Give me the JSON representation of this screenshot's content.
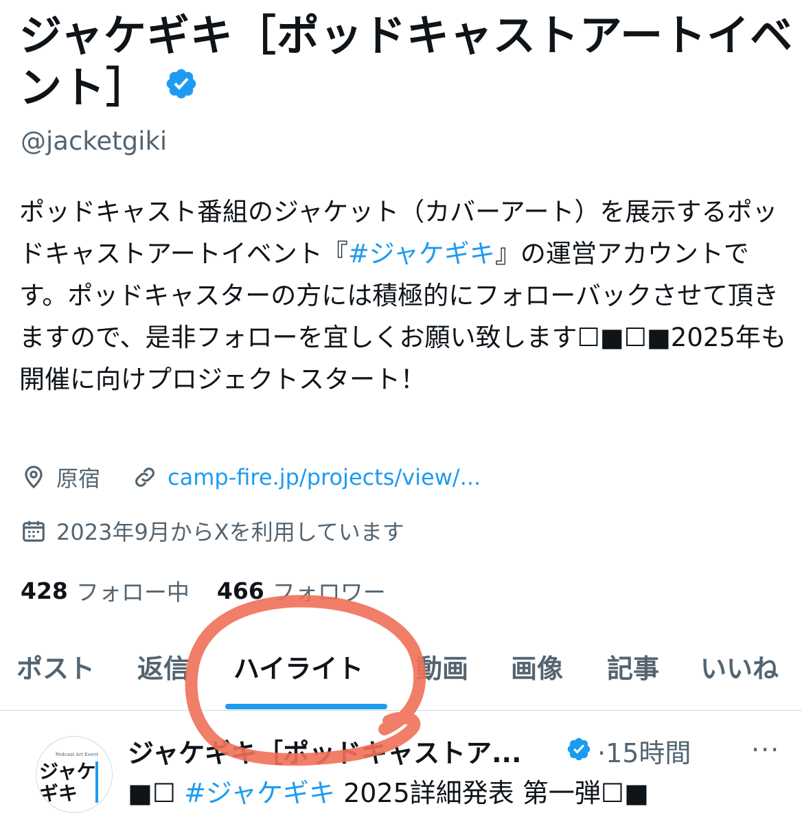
{
  "profile": {
    "name_line1": "ジャケギキ［ポッドキャストアートイベ",
    "name_line2": "ント］",
    "handle": "@jacketgiki",
    "bio_before_tag": "ポッドキャスト番組のジャケット（カバーアート）を展示するポッドキャストアートイベント『",
    "bio_tag": "#ジャケギキ",
    "bio_after_tag": "』の運営アカウントです。ポッドキャスターの方には積極的にフォローバックさせて頂きますので、是非フォローを宜しくお願い致します☐■☐■2025年も開催に向けプロジェクトスタート！",
    "location": "原宿",
    "link": "camp-fire.jp/projects/view/...",
    "joined": "2023年9月からXを利用しています",
    "following_count": "428",
    "following_label": "フォロー中",
    "followers_count": "466",
    "followers_label": "フォロワー"
  },
  "tabs": [
    {
      "label": "ポスト"
    },
    {
      "label": "返信"
    },
    {
      "label": "ハイライト"
    },
    {
      "label": "動画"
    },
    {
      "label": "画像"
    },
    {
      "label": "記事"
    },
    {
      "label": "いいね"
    }
  ],
  "active_tab": "ハイライト",
  "post": {
    "author": "ジャケギキ［ポッドキャストア...",
    "time": "·15時間",
    "more": "···",
    "text_prefix": "■☐ ",
    "text_tag": "#ジャケギキ",
    "text_rest": " 2025詳細発表 第一弾☐■",
    "avatar_small_text": "Podcast Art Event",
    "avatar_text_1": "ジャケ",
    "avatar_text_2": "ギキ"
  },
  "colors": {
    "accent": "#1d9bf0",
    "text": "#0f1419",
    "muted": "#536471",
    "annotation": "#f07058"
  },
  "icons": {
    "verified": "verified-badge-icon",
    "location": "location-pin-icon",
    "link": "link-icon",
    "calendar": "calendar-icon"
  }
}
